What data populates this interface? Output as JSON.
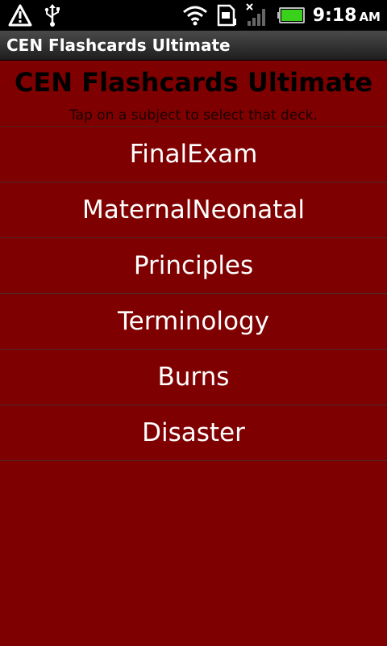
{
  "status_bar": {
    "time": "9:18",
    "ampm": "AM",
    "icons": [
      "warning-icon",
      "usb-icon",
      "wifi-icon",
      "sd-card-icon",
      "signal-off-icon",
      "battery-icon"
    ]
  },
  "title_bar": {
    "title": "CEN Flashcards Ultimate"
  },
  "main": {
    "heading": "CEN Flashcards Ultimate",
    "subheading": "Tap on a subject to select that deck.",
    "decks": [
      {
        "label": "FinalExam"
      },
      {
        "label": "MaternalNeonatal"
      },
      {
        "label": "Principles"
      },
      {
        "label": "Terminology"
      },
      {
        "label": "Burns"
      },
      {
        "label": "Disaster"
      }
    ]
  },
  "colors": {
    "background": "#7f0000",
    "battery": "#39d11c"
  }
}
